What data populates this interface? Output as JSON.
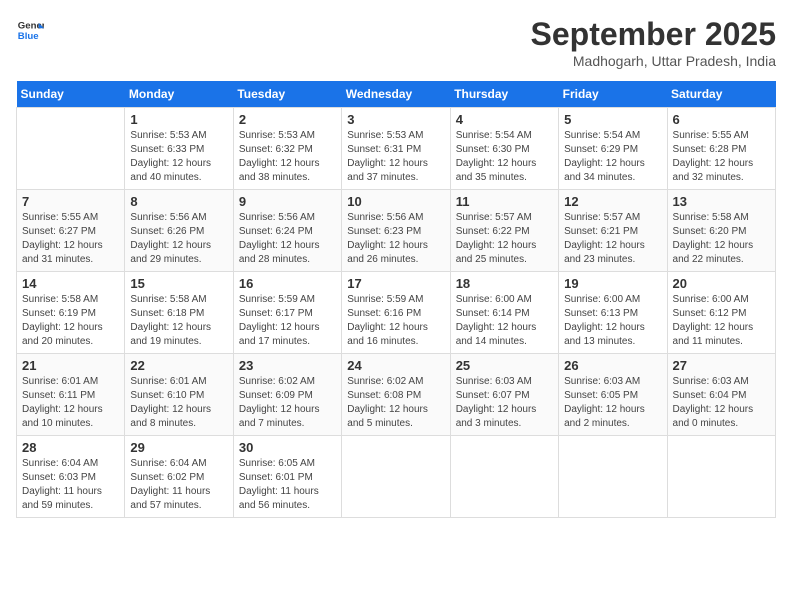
{
  "header": {
    "logo_line1": "General",
    "logo_line2": "Blue",
    "month": "September 2025",
    "location": "Madhogarh, Uttar Pradesh, India"
  },
  "days_of_week": [
    "Sunday",
    "Monday",
    "Tuesday",
    "Wednesday",
    "Thursday",
    "Friday",
    "Saturday"
  ],
  "weeks": [
    [
      {
        "num": "",
        "sunrise": "",
        "sunset": "",
        "daylight": ""
      },
      {
        "num": "1",
        "sunrise": "Sunrise: 5:53 AM",
        "sunset": "Sunset: 6:33 PM",
        "daylight": "Daylight: 12 hours and 40 minutes."
      },
      {
        "num": "2",
        "sunrise": "Sunrise: 5:53 AM",
        "sunset": "Sunset: 6:32 PM",
        "daylight": "Daylight: 12 hours and 38 minutes."
      },
      {
        "num": "3",
        "sunrise": "Sunrise: 5:53 AM",
        "sunset": "Sunset: 6:31 PM",
        "daylight": "Daylight: 12 hours and 37 minutes."
      },
      {
        "num": "4",
        "sunrise": "Sunrise: 5:54 AM",
        "sunset": "Sunset: 6:30 PM",
        "daylight": "Daylight: 12 hours and 35 minutes."
      },
      {
        "num": "5",
        "sunrise": "Sunrise: 5:54 AM",
        "sunset": "Sunset: 6:29 PM",
        "daylight": "Daylight: 12 hours and 34 minutes."
      },
      {
        "num": "6",
        "sunrise": "Sunrise: 5:55 AM",
        "sunset": "Sunset: 6:28 PM",
        "daylight": "Daylight: 12 hours and 32 minutes."
      }
    ],
    [
      {
        "num": "7",
        "sunrise": "Sunrise: 5:55 AM",
        "sunset": "Sunset: 6:27 PM",
        "daylight": "Daylight: 12 hours and 31 minutes."
      },
      {
        "num": "8",
        "sunrise": "Sunrise: 5:56 AM",
        "sunset": "Sunset: 6:26 PM",
        "daylight": "Daylight: 12 hours and 29 minutes."
      },
      {
        "num": "9",
        "sunrise": "Sunrise: 5:56 AM",
        "sunset": "Sunset: 6:24 PM",
        "daylight": "Daylight: 12 hours and 28 minutes."
      },
      {
        "num": "10",
        "sunrise": "Sunrise: 5:56 AM",
        "sunset": "Sunset: 6:23 PM",
        "daylight": "Daylight: 12 hours and 26 minutes."
      },
      {
        "num": "11",
        "sunrise": "Sunrise: 5:57 AM",
        "sunset": "Sunset: 6:22 PM",
        "daylight": "Daylight: 12 hours and 25 minutes."
      },
      {
        "num": "12",
        "sunrise": "Sunrise: 5:57 AM",
        "sunset": "Sunset: 6:21 PM",
        "daylight": "Daylight: 12 hours and 23 minutes."
      },
      {
        "num": "13",
        "sunrise": "Sunrise: 5:58 AM",
        "sunset": "Sunset: 6:20 PM",
        "daylight": "Daylight: 12 hours and 22 minutes."
      }
    ],
    [
      {
        "num": "14",
        "sunrise": "Sunrise: 5:58 AM",
        "sunset": "Sunset: 6:19 PM",
        "daylight": "Daylight: 12 hours and 20 minutes."
      },
      {
        "num": "15",
        "sunrise": "Sunrise: 5:58 AM",
        "sunset": "Sunset: 6:18 PM",
        "daylight": "Daylight: 12 hours and 19 minutes."
      },
      {
        "num": "16",
        "sunrise": "Sunrise: 5:59 AM",
        "sunset": "Sunset: 6:17 PM",
        "daylight": "Daylight: 12 hours and 17 minutes."
      },
      {
        "num": "17",
        "sunrise": "Sunrise: 5:59 AM",
        "sunset": "Sunset: 6:16 PM",
        "daylight": "Daylight: 12 hours and 16 minutes."
      },
      {
        "num": "18",
        "sunrise": "Sunrise: 6:00 AM",
        "sunset": "Sunset: 6:14 PM",
        "daylight": "Daylight: 12 hours and 14 minutes."
      },
      {
        "num": "19",
        "sunrise": "Sunrise: 6:00 AM",
        "sunset": "Sunset: 6:13 PM",
        "daylight": "Daylight: 12 hours and 13 minutes."
      },
      {
        "num": "20",
        "sunrise": "Sunrise: 6:00 AM",
        "sunset": "Sunset: 6:12 PM",
        "daylight": "Daylight: 12 hours and 11 minutes."
      }
    ],
    [
      {
        "num": "21",
        "sunrise": "Sunrise: 6:01 AM",
        "sunset": "Sunset: 6:11 PM",
        "daylight": "Daylight: 12 hours and 10 minutes."
      },
      {
        "num": "22",
        "sunrise": "Sunrise: 6:01 AM",
        "sunset": "Sunset: 6:10 PM",
        "daylight": "Daylight: 12 hours and 8 minutes."
      },
      {
        "num": "23",
        "sunrise": "Sunrise: 6:02 AM",
        "sunset": "Sunset: 6:09 PM",
        "daylight": "Daylight: 12 hours and 7 minutes."
      },
      {
        "num": "24",
        "sunrise": "Sunrise: 6:02 AM",
        "sunset": "Sunset: 6:08 PM",
        "daylight": "Daylight: 12 hours and 5 minutes."
      },
      {
        "num": "25",
        "sunrise": "Sunrise: 6:03 AM",
        "sunset": "Sunset: 6:07 PM",
        "daylight": "Daylight: 12 hours and 3 minutes."
      },
      {
        "num": "26",
        "sunrise": "Sunrise: 6:03 AM",
        "sunset": "Sunset: 6:05 PM",
        "daylight": "Daylight: 12 hours and 2 minutes."
      },
      {
        "num": "27",
        "sunrise": "Sunrise: 6:03 AM",
        "sunset": "Sunset: 6:04 PM",
        "daylight": "Daylight: 12 hours and 0 minutes."
      }
    ],
    [
      {
        "num": "28",
        "sunrise": "Sunrise: 6:04 AM",
        "sunset": "Sunset: 6:03 PM",
        "daylight": "Daylight: 11 hours and 59 minutes."
      },
      {
        "num": "29",
        "sunrise": "Sunrise: 6:04 AM",
        "sunset": "Sunset: 6:02 PM",
        "daylight": "Daylight: 11 hours and 57 minutes."
      },
      {
        "num": "30",
        "sunrise": "Sunrise: 6:05 AM",
        "sunset": "Sunset: 6:01 PM",
        "daylight": "Daylight: 11 hours and 56 minutes."
      },
      {
        "num": "",
        "sunrise": "",
        "sunset": "",
        "daylight": ""
      },
      {
        "num": "",
        "sunrise": "",
        "sunset": "",
        "daylight": ""
      },
      {
        "num": "",
        "sunrise": "",
        "sunset": "",
        "daylight": ""
      },
      {
        "num": "",
        "sunrise": "",
        "sunset": "",
        "daylight": ""
      }
    ]
  ]
}
